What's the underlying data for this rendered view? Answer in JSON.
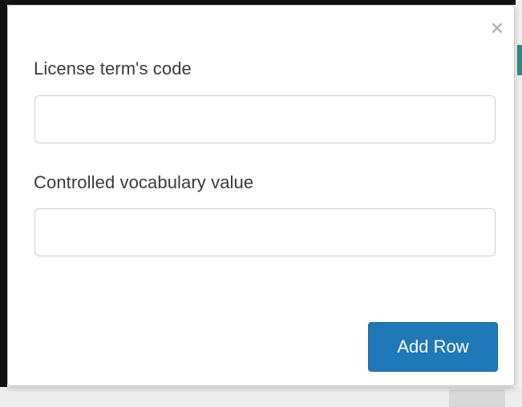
{
  "dialog": {
    "close_symbol": "×",
    "fields": [
      {
        "label": "License term's code",
        "value": "",
        "placeholder": ""
      },
      {
        "label": "Controlled vocabulary value",
        "value": "",
        "placeholder": ""
      }
    ],
    "add_row_label": "Add Row"
  },
  "colors": {
    "primary_button": "#1f78b8",
    "close_icon": "#b5b5b5",
    "label_text": "#3a3a3a",
    "input_border": "#cfcfcf"
  },
  "icons": {
    "close": "close-icon"
  }
}
